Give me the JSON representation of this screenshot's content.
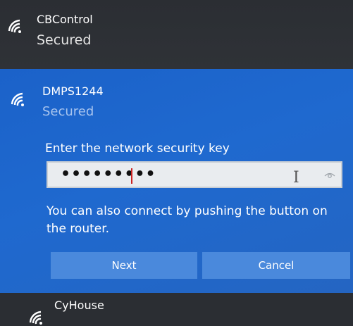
{
  "networks": {
    "top": {
      "name": "CBControl",
      "status": "Secured"
    },
    "selected": {
      "name": "DMPS1244",
      "status": "Secured",
      "key_label": "Enter the network security key",
      "key_value": "•••••••••",
      "hint": "You can also connect by pushing the button on the router.",
      "next_label": "Next",
      "cancel_label": "Cancel"
    },
    "bottom": {
      "name": "CyHouse"
    }
  },
  "icons": {
    "wifi": "wifi-icon",
    "reveal": "eye-icon",
    "cursor": "text-cursor-icon"
  },
  "colors": {
    "selected_bg": "#1f69cf",
    "button_bg": "#4a89dc",
    "status_selected": "#a8c4ee",
    "dark_bg": "#2b2e33"
  }
}
